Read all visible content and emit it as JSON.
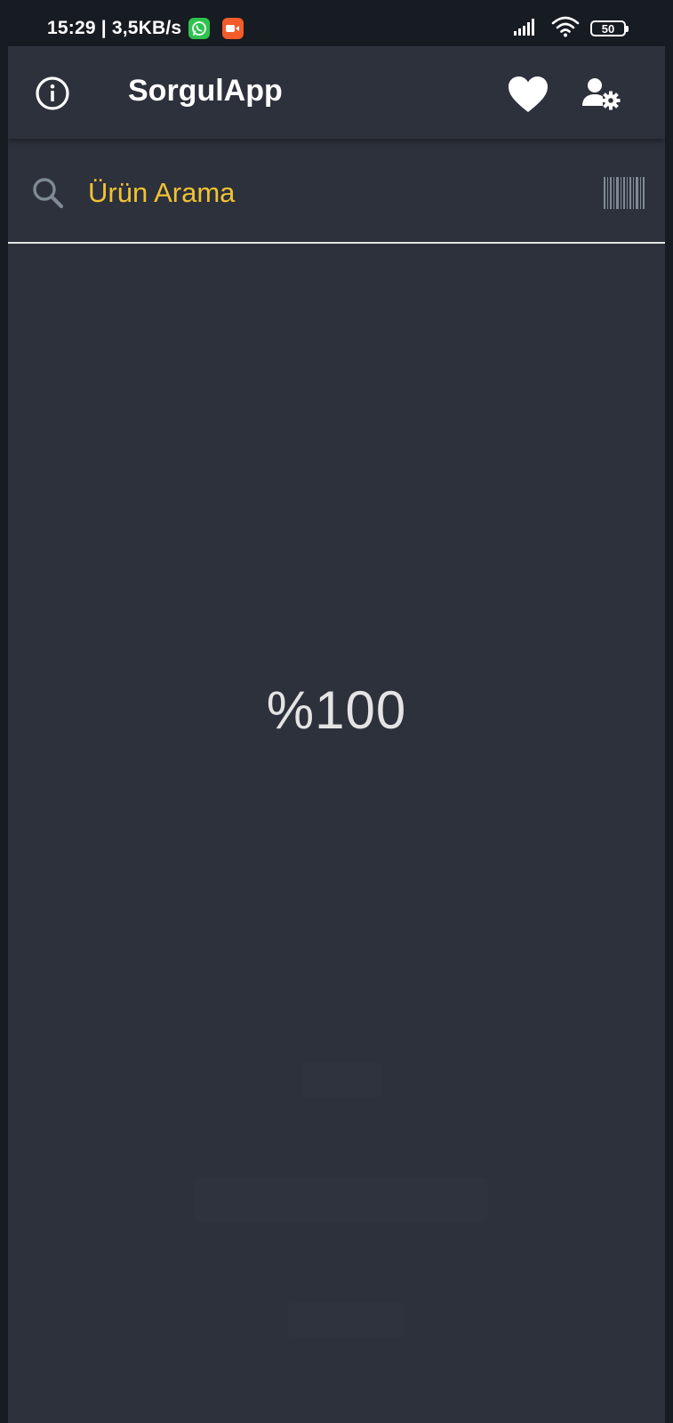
{
  "status_bar": {
    "time": "15:29",
    "network_speed": "| 3,5KB/s",
    "notification_icons": [
      "whatsapp-icon",
      "screen-recorder-icon"
    ],
    "signal_icon": "cellular-signal-icon",
    "wifi_icon": "wifi-icon",
    "battery_level": "50"
  },
  "app_bar": {
    "title": "SorgulApp",
    "left_icon": "info-icon",
    "right_icons": [
      "heart-icon",
      "user-settings-icon"
    ]
  },
  "search": {
    "placeholder": "Ürün Arama",
    "value": "",
    "left_icon": "search-icon",
    "right_icon": "barcode-icon"
  },
  "main": {
    "progress_text": "%100",
    "progress_percent": 100
  },
  "colors": {
    "background": "#2d313c",
    "status_bar": "#171b22",
    "accent_yellow": "#f1c232",
    "text_primary": "#ffffff",
    "divider": "#e6e6e6"
  }
}
